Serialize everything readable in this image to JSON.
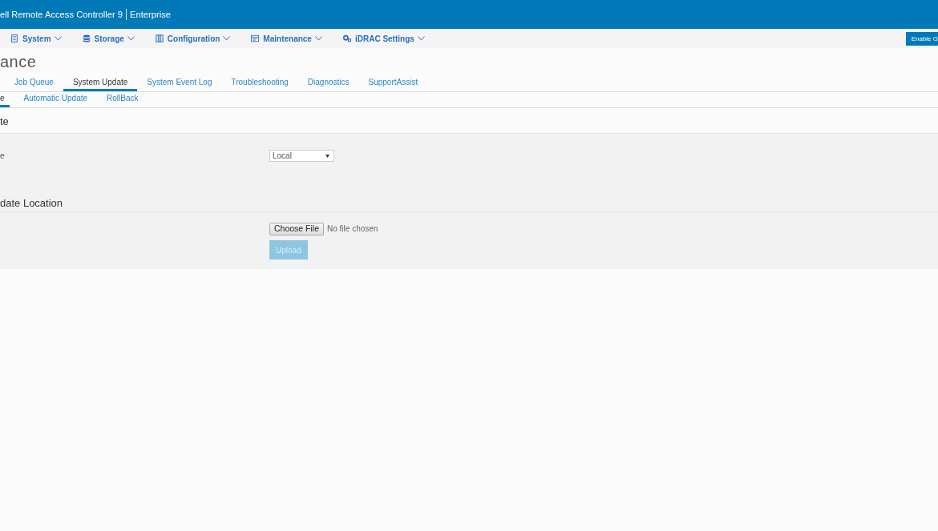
{
  "header": {
    "title": "ell Remote Access Controller 9",
    "edition": "Enterprise"
  },
  "nav": {
    "items": [
      {
        "label": "System"
      },
      {
        "label": "Storage"
      },
      {
        "label": "Configuration"
      },
      {
        "label": "Maintenance"
      },
      {
        "label": "iDRAC Settings"
      }
    ],
    "action": "Enable G"
  },
  "page_title": "ance",
  "tabs": [
    {
      "label": "Job Queue",
      "selected": false
    },
    {
      "label": "System Update",
      "selected": true
    },
    {
      "label": "System Event Log",
      "selected": false
    },
    {
      "label": "Troubleshooting",
      "selected": false
    },
    {
      "label": "Diagnostics",
      "selected": false
    },
    {
      "label": "SupportAssist",
      "selected": false
    }
  ],
  "subtabs": [
    {
      "label": "e",
      "selected": true
    },
    {
      "label": "Automatic Update",
      "selected": false
    },
    {
      "label": "RollBack",
      "selected": false
    }
  ],
  "sections": [
    {
      "heading": "te",
      "rows": [
        {
          "kind": "select",
          "label": "e",
          "value": "Local"
        }
      ]
    },
    {
      "heading": "date Location",
      "rows": [
        {
          "kind": "file",
          "button": "Choose File",
          "status": "No file chosen"
        },
        {
          "kind": "button",
          "label": "Upload",
          "disabled": true
        }
      ]
    }
  ]
}
